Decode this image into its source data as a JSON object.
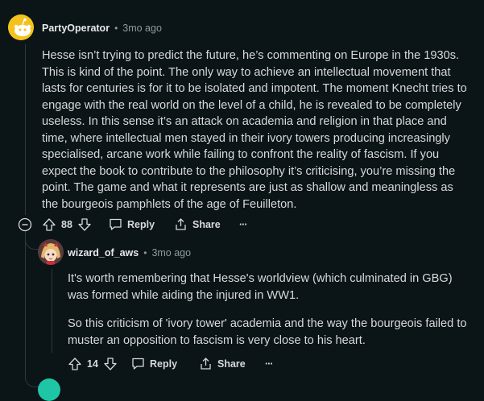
{
  "comment": {
    "username": "PartyOperator",
    "separator": "•",
    "time": "3mo ago",
    "paragraph": "Hesse isn’t trying to predict the future, he’s commenting on Europe in the 1930s. This is kind of the point. The only way to achieve an intellectual movement that lasts for centuries is for it to be isolated and impotent. The moment Knecht tries to engage with the real world on the level of a child, he is revealed to be completely useless. In this sense it’s an attack on academia and religion in that place and time, where intellectual men stayed in their ivory towers producing increasingly specialised, arcane work while failing to confront the reality of fascism. If you expect the book to contribute to the philosophy it’s criticising, you’re missing the point. The game and what it represents are just as shallow and meaningless as the bourgeois pamphlets of the age of Feuilleton.",
    "votes": "88",
    "reply_label": "Reply",
    "share_label": "Share",
    "more_label": "···",
    "avatar_color": "#f4c21c"
  },
  "reply": {
    "username": "wizard_of_aws",
    "separator": "•",
    "time": "3mo ago",
    "paragraph1": "It's worth remembering that Hesse's worldview (which culminated in GBG) was formed while aiding the injured in WW1.",
    "paragraph2": "So this criticism of 'ivory tower' academia and the way the bourgeois failed to muster an opposition to fascism is very close to his heart.",
    "votes": "14",
    "reply_label": "Reply",
    "share_label": "Share",
    "more_label": "···"
  },
  "next_avatar_color": "#1fc6a6"
}
